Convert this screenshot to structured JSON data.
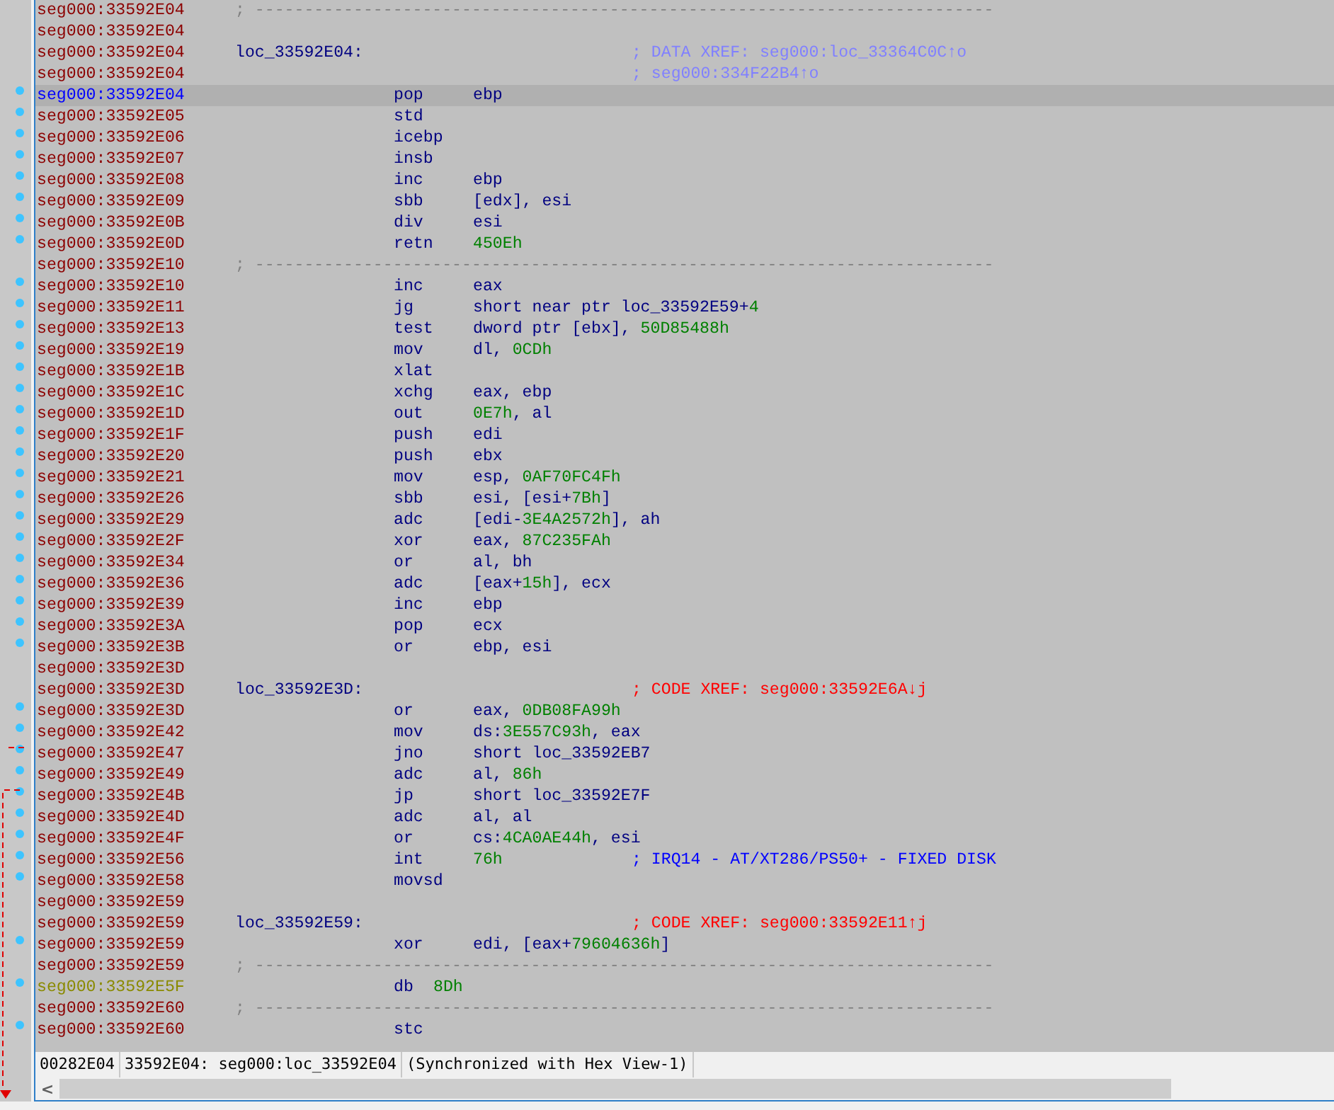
{
  "rows": [
    {
      "address": "seg000:33592E04",
      "is_data": false,
      "selected": false,
      "marked": false,
      "kind": "separator",
      "text": "; ---------------------------------------------------------------------------"
    },
    {
      "address": "seg000:33592E04",
      "is_data": false,
      "selected": false,
      "marked": false,
      "kind": "blank"
    },
    {
      "address": "seg000:33592E04",
      "is_data": false,
      "selected": false,
      "marked": false,
      "kind": "label",
      "label": "loc_33592E04:",
      "comment": "; DATA XREF: seg000:loc_33364C0C↑o",
      "color": "#8080ff"
    },
    {
      "address": "seg000:33592E04",
      "is_data": false,
      "selected": false,
      "marked": false,
      "kind": "comment",
      "comment": "; seg000:334F22B4↑o",
      "color": "#8080ff"
    },
    {
      "address": "seg000:33592E04",
      "is_data": false,
      "selected": true,
      "marked": true,
      "kind": "insn",
      "mnemonic": "pop",
      "operands": [
        {
          "text": "ebp",
          "kind": "symbol"
        }
      ]
    },
    {
      "address": "seg000:33592E05",
      "is_data": false,
      "selected": false,
      "marked": true,
      "kind": "insn",
      "mnemonic": "std",
      "operands": []
    },
    {
      "address": "seg000:33592E06",
      "is_data": false,
      "selected": false,
      "marked": true,
      "kind": "insn",
      "mnemonic": "icebp",
      "operands": []
    },
    {
      "address": "seg000:33592E07",
      "is_data": false,
      "selected": false,
      "marked": true,
      "kind": "insn",
      "mnemonic": "insb",
      "operands": []
    },
    {
      "address": "seg000:33592E08",
      "is_data": false,
      "selected": false,
      "marked": true,
      "kind": "insn",
      "mnemonic": "inc",
      "operands": [
        {
          "text": "ebp",
          "kind": "symbol"
        }
      ]
    },
    {
      "address": "seg000:33592E09",
      "is_data": false,
      "selected": false,
      "marked": true,
      "kind": "insn",
      "mnemonic": "sbb",
      "operands": [
        {
          "text": "[edx], esi",
          "kind": "symbol"
        }
      ]
    },
    {
      "address": "seg000:33592E0B",
      "is_data": false,
      "selected": false,
      "marked": true,
      "kind": "insn",
      "mnemonic": "div",
      "operands": [
        {
          "text": "esi",
          "kind": "symbol"
        }
      ]
    },
    {
      "address": "seg000:33592E0D",
      "is_data": false,
      "selected": false,
      "marked": true,
      "kind": "insn",
      "mnemonic": "retn",
      "operands": [
        {
          "text": "450Eh",
          "kind": "number"
        }
      ]
    },
    {
      "address": "seg000:33592E10",
      "is_data": false,
      "selected": false,
      "marked": false,
      "kind": "separator",
      "text": "; ---------------------------------------------------------------------------"
    },
    {
      "address": "seg000:33592E10",
      "is_data": false,
      "selected": false,
      "marked": true,
      "kind": "insn",
      "mnemonic": "inc",
      "operands": [
        {
          "text": "eax",
          "kind": "symbol"
        }
      ]
    },
    {
      "address": "seg000:33592E11",
      "is_data": false,
      "selected": false,
      "marked": true,
      "kind": "insn",
      "mnemonic": "jg",
      "operands": [
        {
          "text": "short near ptr loc_33592E59+",
          "kind": "symbol"
        },
        {
          "text": "4",
          "kind": "number"
        }
      ]
    },
    {
      "address": "seg000:33592E13",
      "is_data": false,
      "selected": false,
      "marked": true,
      "kind": "insn",
      "mnemonic": "test",
      "operands": [
        {
          "text": "dword ptr [ebx], ",
          "kind": "symbol"
        },
        {
          "text": "50D85488h",
          "kind": "number"
        }
      ]
    },
    {
      "address": "seg000:33592E19",
      "is_data": false,
      "selected": false,
      "marked": true,
      "kind": "insn",
      "mnemonic": "mov",
      "operands": [
        {
          "text": "dl, ",
          "kind": "symbol"
        },
        {
          "text": "0CDh",
          "kind": "number"
        }
      ]
    },
    {
      "address": "seg000:33592E1B",
      "is_data": false,
      "selected": false,
      "marked": true,
      "kind": "insn",
      "mnemonic": "xlat",
      "operands": []
    },
    {
      "address": "seg000:33592E1C",
      "is_data": false,
      "selected": false,
      "marked": true,
      "kind": "insn",
      "mnemonic": "xchg",
      "operands": [
        {
          "text": "eax, ebp",
          "kind": "symbol"
        }
      ]
    },
    {
      "address": "seg000:33592E1D",
      "is_data": false,
      "selected": false,
      "marked": true,
      "kind": "insn",
      "mnemonic": "out",
      "operands": [
        {
          "text": "0E7h",
          "kind": "number"
        },
        {
          "text": ", al",
          "kind": "symbol"
        }
      ]
    },
    {
      "address": "seg000:33592E1F",
      "is_data": false,
      "selected": false,
      "marked": true,
      "kind": "insn",
      "mnemonic": "push",
      "operands": [
        {
          "text": "edi",
          "kind": "symbol"
        }
      ]
    },
    {
      "address": "seg000:33592E20",
      "is_data": false,
      "selected": false,
      "marked": true,
      "kind": "insn",
      "mnemonic": "push",
      "operands": [
        {
          "text": "ebx",
          "kind": "symbol"
        }
      ]
    },
    {
      "address": "seg000:33592E21",
      "is_data": false,
      "selected": false,
      "marked": true,
      "kind": "insn",
      "mnemonic": "mov",
      "operands": [
        {
          "text": "esp, ",
          "kind": "symbol"
        },
        {
          "text": "0AF70FC4Fh",
          "kind": "number"
        }
      ]
    },
    {
      "address": "seg000:33592E26",
      "is_data": false,
      "selected": false,
      "marked": true,
      "kind": "insn",
      "mnemonic": "sbb",
      "operands": [
        {
          "text": "esi, [esi+",
          "kind": "symbol"
        },
        {
          "text": "7Bh",
          "kind": "number"
        },
        {
          "text": "]",
          "kind": "symbol"
        }
      ]
    },
    {
      "address": "seg000:33592E29",
      "is_data": false,
      "selected": false,
      "marked": true,
      "kind": "insn",
      "mnemonic": "adc",
      "operands": [
        {
          "text": "[edi-",
          "kind": "symbol"
        },
        {
          "text": "3E4A2572h",
          "kind": "number"
        },
        {
          "text": "], ah",
          "kind": "symbol"
        }
      ]
    },
    {
      "address": "seg000:33592E2F",
      "is_data": false,
      "selected": false,
      "marked": true,
      "kind": "insn",
      "mnemonic": "xor",
      "operands": [
        {
          "text": "eax, ",
          "kind": "symbol"
        },
        {
          "text": "87C235FAh",
          "kind": "number"
        }
      ]
    },
    {
      "address": "seg000:33592E34",
      "is_data": false,
      "selected": false,
      "marked": true,
      "kind": "insn",
      "mnemonic": "or",
      "operands": [
        {
          "text": "al, bh",
          "kind": "symbol"
        }
      ]
    },
    {
      "address": "seg000:33592E36",
      "is_data": false,
      "selected": false,
      "marked": true,
      "kind": "insn",
      "mnemonic": "adc",
      "operands": [
        {
          "text": "[eax+",
          "kind": "symbol"
        },
        {
          "text": "15h",
          "kind": "number"
        },
        {
          "text": "], ecx",
          "kind": "symbol"
        }
      ]
    },
    {
      "address": "seg000:33592E39",
      "is_data": false,
      "selected": false,
      "marked": true,
      "kind": "insn",
      "mnemonic": "inc",
      "operands": [
        {
          "text": "ebp",
          "kind": "symbol"
        }
      ]
    },
    {
      "address": "seg000:33592E3A",
      "is_data": false,
      "selected": false,
      "marked": true,
      "kind": "insn",
      "mnemonic": "pop",
      "operands": [
        {
          "text": "ecx",
          "kind": "symbol"
        }
      ]
    },
    {
      "address": "seg000:33592E3B",
      "is_data": false,
      "selected": false,
      "marked": true,
      "kind": "insn",
      "mnemonic": "or",
      "operands": [
        {
          "text": "ebp, esi",
          "kind": "symbol"
        }
      ]
    },
    {
      "address": "seg000:33592E3D",
      "is_data": false,
      "selected": false,
      "marked": false,
      "kind": "blank"
    },
    {
      "address": "seg000:33592E3D",
      "is_data": false,
      "selected": false,
      "marked": false,
      "kind": "label",
      "label": "loc_33592E3D:",
      "comment": "; CODE XREF: seg000:33592E6A↓j",
      "color": "#ff0000"
    },
    {
      "address": "seg000:33592E3D",
      "is_data": false,
      "selected": false,
      "marked": true,
      "kind": "insn",
      "mnemonic": "or",
      "operands": [
        {
          "text": "eax, ",
          "kind": "symbol"
        },
        {
          "text": "0DB08FA99h",
          "kind": "number"
        }
      ]
    },
    {
      "address": "seg000:33592E42",
      "is_data": false,
      "selected": false,
      "marked": true,
      "kind": "insn",
      "mnemonic": "mov",
      "operands": [
        {
          "text": "ds:",
          "kind": "symbol"
        },
        {
          "text": "3E557C93h",
          "kind": "number"
        },
        {
          "text": ", eax",
          "kind": "symbol"
        }
      ]
    },
    {
      "address": "seg000:33592E47",
      "is_data": false,
      "selected": false,
      "marked": true,
      "kind": "insn",
      "mnemonic": "jno",
      "operands": [
        {
          "text": "short loc_33592EB7",
          "kind": "symbol"
        }
      ]
    },
    {
      "address": "seg000:33592E49",
      "is_data": false,
      "selected": false,
      "marked": true,
      "kind": "insn",
      "mnemonic": "adc",
      "operands": [
        {
          "text": "al, ",
          "kind": "symbol"
        },
        {
          "text": "86h",
          "kind": "number"
        }
      ]
    },
    {
      "address": "seg000:33592E4B",
      "is_data": false,
      "selected": false,
      "marked": true,
      "kind": "insn",
      "mnemonic": "jp",
      "operands": [
        {
          "text": "short loc_33592E7F",
          "kind": "symbol"
        }
      ]
    },
    {
      "address": "seg000:33592E4D",
      "is_data": false,
      "selected": false,
      "marked": true,
      "kind": "insn",
      "mnemonic": "adc",
      "operands": [
        {
          "text": "al, al",
          "kind": "symbol"
        }
      ]
    },
    {
      "address": "seg000:33592E4F",
      "is_data": false,
      "selected": false,
      "marked": true,
      "kind": "insn",
      "mnemonic": "or",
      "operands": [
        {
          "text": "cs:",
          "kind": "symbol"
        },
        {
          "text": "4CA0AE44h",
          "kind": "number"
        },
        {
          "text": ", esi",
          "kind": "symbol"
        }
      ]
    },
    {
      "address": "seg000:33592E56",
      "is_data": false,
      "selected": false,
      "marked": true,
      "kind": "insn",
      "mnemonic": "int",
      "operands": [
        {
          "text": "76h",
          "kind": "number"
        }
      ],
      "comment": "; IRQ14 - AT/XT286/PS50+ - FIXED DISK",
      "color": "#0000ff"
    },
    {
      "address": "seg000:33592E58",
      "is_data": false,
      "selected": false,
      "marked": true,
      "kind": "insn",
      "mnemonic": "movsd",
      "operands": []
    },
    {
      "address": "seg000:33592E59",
      "is_data": false,
      "selected": false,
      "marked": false,
      "kind": "blank"
    },
    {
      "address": "seg000:33592E59",
      "is_data": false,
      "selected": false,
      "marked": false,
      "kind": "label",
      "label": "loc_33592E59:",
      "comment": "; CODE XREF: seg000:33592E11↑j",
      "color": "#ff0000"
    },
    {
      "address": "seg000:33592E59",
      "is_data": false,
      "selected": false,
      "marked": true,
      "kind": "insn",
      "mnemonic": "xor",
      "operands": [
        {
          "text": "edi, [eax+",
          "kind": "symbol"
        },
        {
          "text": "79604636h",
          "kind": "number"
        },
        {
          "text": "]",
          "kind": "symbol"
        }
      ]
    },
    {
      "address": "seg000:33592E59",
      "is_data": false,
      "selected": false,
      "marked": false,
      "kind": "separator",
      "text": "; ---------------------------------------------------------------------------"
    },
    {
      "address": "seg000:33592E5F",
      "is_data": true,
      "selected": false,
      "marked": true,
      "kind": "data",
      "directive": "db",
      "value": "8Dh"
    },
    {
      "address": "seg000:33592E60",
      "is_data": false,
      "selected": false,
      "marked": false,
      "kind": "separator",
      "text": "; ---------------------------------------------------------------------------"
    },
    {
      "address": "seg000:33592E60",
      "is_data": false,
      "selected": false,
      "marked": true,
      "kind": "insn",
      "mnemonic": "stc",
      "operands": []
    }
  ],
  "status_bar": [
    "00282E04",
    "33592E04: seg000:loc_33592E04",
    "(Synchronized with Hex View-1)"
  ],
  "scrollbar": {
    "left_button": "<"
  }
}
